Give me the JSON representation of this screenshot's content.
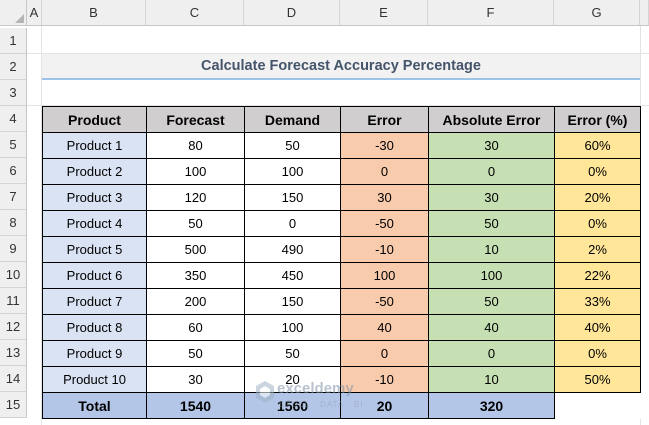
{
  "columns": [
    "A",
    "B",
    "C",
    "D",
    "E",
    "F",
    "G"
  ],
  "rows": [
    "1",
    "2",
    "3",
    "4",
    "5",
    "6",
    "7",
    "8",
    "9",
    "10",
    "11",
    "12",
    "13",
    "14",
    "15"
  ],
  "title": "Calculate Forecast Accuracy Percentage",
  "table": {
    "headers": [
      "Product",
      "Forecast",
      "Demand",
      "Error",
      "Absolute Error",
      "Error (%)"
    ],
    "rows": [
      [
        "Product 1",
        "80",
        "50",
        "-30",
        "30",
        "60%"
      ],
      [
        "Product 2",
        "100",
        "100",
        "0",
        "0",
        "0%"
      ],
      [
        "Product 3",
        "120",
        "150",
        "30",
        "30",
        "20%"
      ],
      [
        "Product 4",
        "50",
        "0",
        "-50",
        "50",
        "0%"
      ],
      [
        "Product 5",
        "500",
        "490",
        "-10",
        "10",
        "2%"
      ],
      [
        "Product 6",
        "350",
        "450",
        "100",
        "100",
        "22%"
      ],
      [
        "Product 7",
        "200",
        "150",
        "-50",
        "50",
        "33%"
      ],
      [
        "Product 8",
        "60",
        "100",
        "40",
        "40",
        "40%"
      ],
      [
        "Product 9",
        "50",
        "50",
        "0",
        "0",
        "0%"
      ],
      [
        "Product 10",
        "30",
        "20",
        "-10",
        "10",
        "50%"
      ]
    ],
    "total": [
      "Total",
      "1540",
      "1560",
      "20",
      "320"
    ]
  },
  "watermark": {
    "name": "exceldemy",
    "tag": "EXCEL · DATA · BI",
    "icon": "exceldemy-logo-icon"
  },
  "colors": {
    "product": "#dae3f3",
    "error": "#f8cbad",
    "absolute": "#c6e0b4",
    "percent": "#ffe699",
    "total": "#b4c6e7",
    "header": "#d0cece"
  }
}
